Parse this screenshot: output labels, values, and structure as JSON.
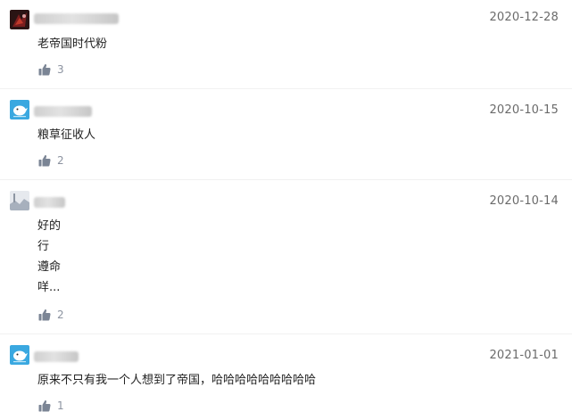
{
  "comments": [
    {
      "avatar": "dark-avatar",
      "date": "2020-12-28",
      "lines": [
        "老帝国时代粉"
      ],
      "likes": "3",
      "like_icon": "thumbs-up-icon"
    },
    {
      "avatar": "blue-bird-avatar",
      "date": "2020-10-15",
      "lines": [
        "粮草征收人"
      ],
      "likes": "2",
      "like_icon": "thumbs-up-icon"
    },
    {
      "avatar": "grey-photo-avatar",
      "date": "2020-10-14",
      "lines": [
        "好的",
        "行",
        "遵命",
        "咩..."
      ],
      "likes": "2",
      "like_icon": "thumbs-up-icon"
    },
    {
      "avatar": "blue-bird-avatar",
      "date": "2021-01-01",
      "lines": [
        "原来不只有我一个人想到了帝国，哈哈哈哈哈哈哈哈哈"
      ],
      "likes": "1",
      "like_icon": "thumbs-up-icon"
    }
  ]
}
